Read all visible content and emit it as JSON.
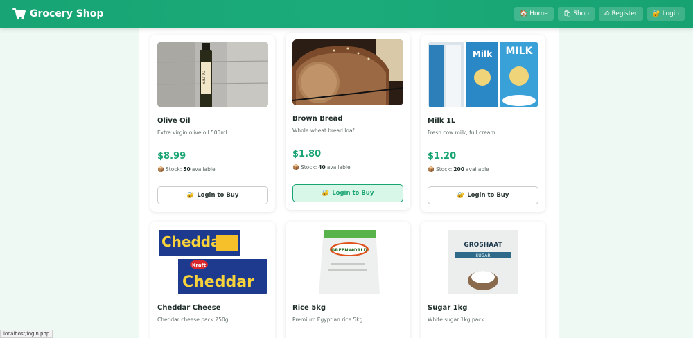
{
  "header": {
    "brand": "Grocery Shop",
    "nav": [
      {
        "label": "Home",
        "icon": "home-icon"
      },
      {
        "label": "Shop",
        "icon": "shop-icon"
      },
      {
        "label": "Register",
        "icon": "register-icon"
      },
      {
        "label": "Login",
        "icon": "login-icon"
      }
    ]
  },
  "products": [
    {
      "name": "Olive Oil",
      "description": "Extra virgin olive oil 500ml",
      "price": "$8.99",
      "stock_prefix": "Stock:",
      "stock": "50",
      "stock_suffix": "available",
      "button": "Login to Buy"
    },
    {
      "name": "Brown Bread",
      "description": "Whole wheat bread loaf",
      "price": "$1.80",
      "stock_prefix": "Stock:",
      "stock": "40",
      "stock_suffix": "available",
      "button": "Login to Buy"
    },
    {
      "name": "Milk 1L",
      "description": "Fresh cow milk, full cream",
      "price": "$1.20",
      "stock_prefix": "Stock:",
      "stock": "200",
      "stock_suffix": "available",
      "button": "Login to Buy"
    },
    {
      "name": "Cheddar Cheese",
      "description": "Cheddar cheese pack 250g"
    },
    {
      "name": "Rice 5kg",
      "description": "Premium Egyptian rice 5kg"
    },
    {
      "name": "Sugar 1kg",
      "description": "White sugar 1kg pack"
    }
  ],
  "image_text": {
    "oil": "OLIVE",
    "milk_a": "Milk",
    "milk_b": "MILK",
    "cheddar": "Cheddar",
    "kraft": "Kraft",
    "rice": "GREENWORLD",
    "sugar_brand": "GROSHAAT",
    "sugar_label": "SUGAR"
  },
  "status_bar": "localhost/login.php",
  "colors": {
    "brand": "#1bab7a",
    "price": "#19a473",
    "active_button_bg": "#d9f7e9"
  }
}
